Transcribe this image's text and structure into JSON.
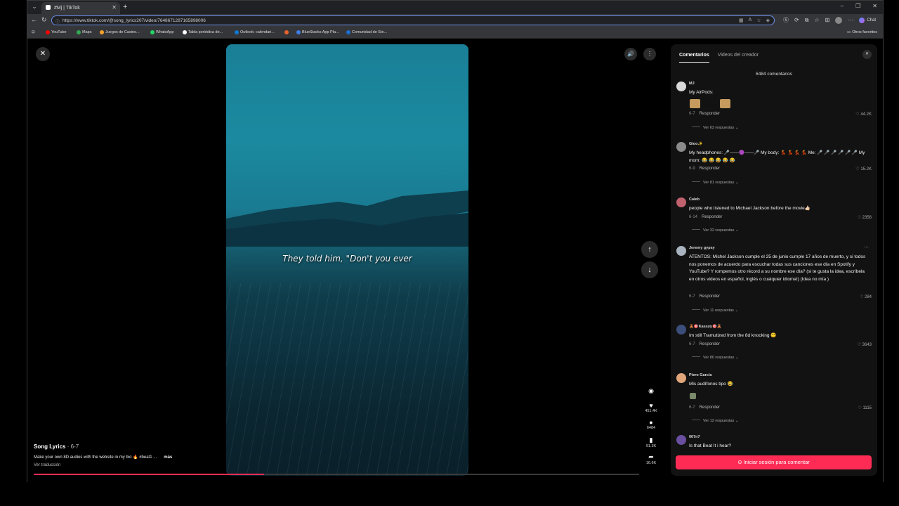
{
  "browser": {
    "tab_title": "#Mj | TikTok",
    "url": "https://www.tiktok.com/@song_lyrics207/video/7648671287165898006",
    "chat_label": "Chat",
    "bookmarks": [
      {
        "label": "YouTube",
        "color": "#ff0000"
      },
      {
        "label": "Maps",
        "color": "#34a853"
      },
      {
        "label": "Juegos de Casino...",
        "color": "#f4a12b"
      },
      {
        "label": "WhatsApp",
        "color": "#25d366"
      },
      {
        "label": "Tabla periódica de...",
        "color": "#ffffff"
      },
      {
        "label": "Outlook: calendari...",
        "color": "#0f78d4"
      },
      {
        "label": "BlueStacks App Pla...",
        "color": "#3f7de8"
      },
      {
        "label": "Comunidad de Ste...",
        "color": "#1b6ed1"
      }
    ],
    "other_favorites": "Otros favoritos"
  },
  "video": {
    "lyric": "They told him, \"Don't you ever",
    "creator": "Song Lyrics",
    "date": "· 6-7",
    "caption": "Make your own 8D audios with the website in my bio 🔥 #beat1 ...",
    "more": "más",
    "translate": "Ver traducción",
    "progress": 0.38,
    "accent": "#fe2c55"
  },
  "actions": {
    "likes": "451.4K",
    "comments": "6484",
    "saves": "91.3K",
    "shares": "16.6K"
  },
  "panel": {
    "tab_comments": "Comentarios",
    "tab_creator_videos": "Videos del creador",
    "count": "6484 comentarios",
    "reply_label": "Responder",
    "login": "Iniciar sesión para comentar"
  },
  "comments": [
    {
      "user": "MJ",
      "text": "My AirPods:",
      "date": "6-7",
      "likes": "44.2K",
      "replies": "Ver 63 respuestas",
      "avatar": "#d9d9d9"
    },
    {
      "user": "Gioo✨",
      "text": "My headphones: 🎤——🟣——🎤 My body: 💃 💃 💃 💃 Me: 🎤 🎤 🎤 🎤 🎤 🎤 My mom: 😂 😂 😂 😂 😂",
      "date": "6-9",
      "likes": "15.2K",
      "replies": "Ver 81 respuestas",
      "avatar": "#8b8b8b"
    },
    {
      "user": "Caleb",
      "text": "people who listened to Michael Jackson before the movie👍🏻",
      "date": "6-14",
      "likes": "2356",
      "replies": "Ver 32 respuestas",
      "avatar": "#c0616e"
    },
    {
      "user": "Jeremy gypsy",
      "text": "ATENTOS: Michel Jackson cumple el 25 de junio cumple 17 años de muerto, y si todos nos ponemos de acuerdo para escuchar todas sus canciones ese día en Spotify y YouTube? Y rompemos otro récord a su nombre ese día? (si te gusta la idea, escríbela en otros videos en español, inglés o cualquier idioma!) (Idea no mía )",
      "date": "6-7",
      "likes": "284",
      "replies": "Ver 11 respuestas",
      "avatar": "#a9b4c0"
    },
    {
      "user": "🧸🎯Kassyy🎯🧸",
      "text": "Im still Tramutized from the 8d knocking 😵‍💫",
      "date": "6-7",
      "likes": "3643",
      "replies": "Ver 80 respuestas",
      "avatar": "#3b4e7a"
    },
    {
      "user": "Piero García",
      "text": "Mis audífonos tipo 😂",
      "date": "6-7",
      "likes": "1115",
      "replies": "Ver 12 respuestas",
      "avatar": "#e0a67a"
    },
    {
      "user": "007n7",
      "text": "Is that Beat It i hear?",
      "date": "",
      "likes": "",
      "replies": "",
      "avatar": "#6a4fa0"
    }
  ]
}
